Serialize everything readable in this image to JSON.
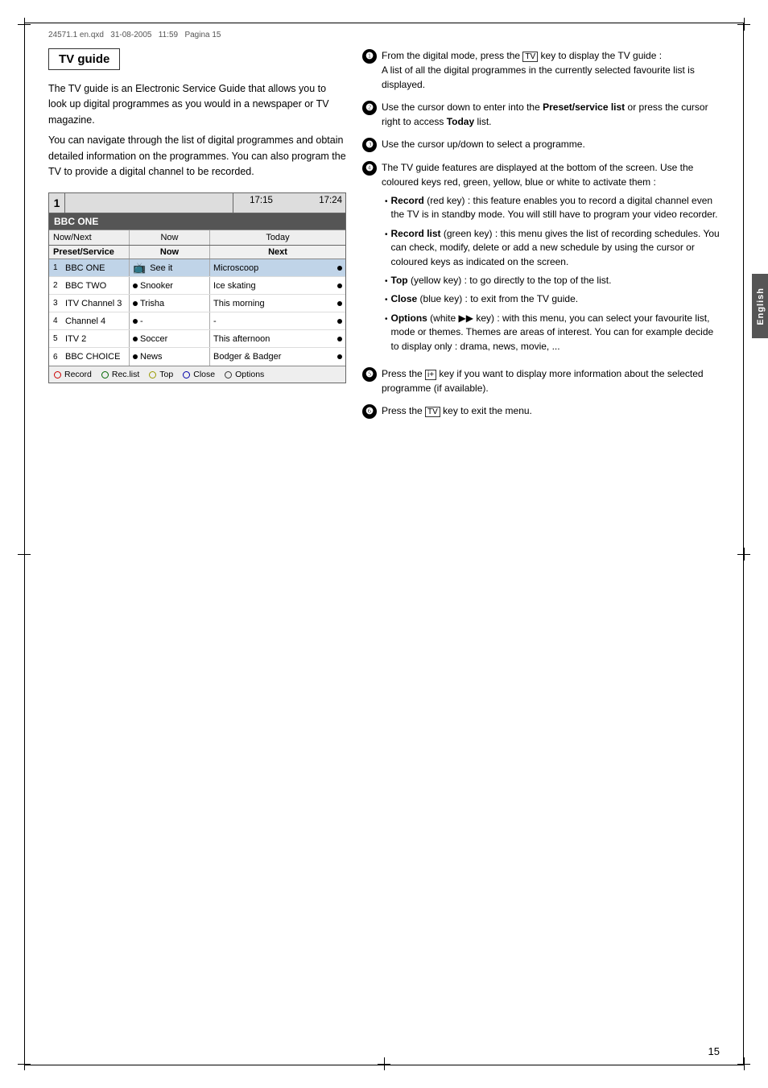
{
  "meta": {
    "doc_id": "24571.1 en.qxd",
    "date": "31-08-2005",
    "time": "11:59",
    "page_label": "Pagina 15"
  },
  "section": {
    "title": "TV guide"
  },
  "intro": {
    "paragraph1": "The TV guide is an Electronic Service Guide that allows you to look up digital programmes as you would in a newspaper or TV magazine.",
    "paragraph2": "You can navigate through the list of digital programmes and obtain detailed information on the programmes. You can also program the TV to provide a digital channel to be recorded."
  },
  "tv_guide_table": {
    "header": {
      "channel_num": "1",
      "time1": "17:15",
      "time2": "17:24"
    },
    "channel_name": "BBC ONE",
    "sub_headers": {
      "preset": "Now/Next",
      "now": "Now",
      "today": "Today"
    },
    "col_headers": {
      "preset_service": "Preset/Service",
      "now": "Now",
      "next": "Next"
    },
    "rows": [
      {
        "num": "1",
        "name": "BBC ONE",
        "now_icon": "tv",
        "now": "See it",
        "next": "Microscoop",
        "next_bullet": true,
        "highlighted": true
      },
      {
        "num": "2",
        "name": "BBC TWO",
        "now_bullet": true,
        "now": "Snooker",
        "next": "Ice skating",
        "next_bullet": true
      },
      {
        "num": "3",
        "name": "ITV Channel 3",
        "now_bullet": true,
        "now": "Trisha",
        "next": "This morning",
        "next_bullet": true
      },
      {
        "num": "4",
        "name": "Channel 4",
        "now_bullet": true,
        "now": "-",
        "next": "-",
        "next_bullet": true
      },
      {
        "num": "5",
        "name": "ITV 2",
        "now_bullet": true,
        "now": "Soccer",
        "next": "This afternoon",
        "next_bullet": true
      },
      {
        "num": "6",
        "name": "BBC CHOICE",
        "now_bullet": true,
        "now": "News",
        "next": "Bodger & Badger",
        "next_bullet": true
      }
    ],
    "bottom_buttons": [
      {
        "label": "Record",
        "color": "red"
      },
      {
        "label": "Rec.list",
        "color": "green"
      },
      {
        "label": "Top",
        "color": "yellow"
      },
      {
        "label": "Close",
        "color": "blue"
      },
      {
        "label": "Options",
        "color": "white"
      }
    ]
  },
  "instructions": {
    "steps": [
      {
        "num": "1",
        "text": "From the digital mode, press the",
        "icon": "TV-GUIDE-key",
        "text2": "key to display the TV guide :",
        "sub": "A list of all the digital programmes in the currently selected favourite list is displayed."
      },
      {
        "num": "2",
        "text": "Use the cursor down to enter into the",
        "bold": "Preset/service list",
        "text2": "or press the cursor right to access",
        "bold2": "Today",
        "text3": "list."
      },
      {
        "num": "3",
        "text": "Use the cursor up/down to select a programme."
      },
      {
        "num": "4",
        "text": "The TV guide features are displayed at the bottom of the screen. Use the coloured keys red, green, yellow, blue or white to activate them :"
      },
      {
        "num": "5",
        "text": "Press the",
        "icon": "info-key",
        "text2": "key if you want to display more information about the selected programme (if available)."
      },
      {
        "num": "6",
        "text": "Press the",
        "icon": "menu-key",
        "text2": "key to exit the menu."
      }
    ],
    "bullets": [
      {
        "label": "Record",
        "label_suffix": " (red key) : this feature enables you to record a digital channel even the TV is in standby mode. You will still have to program your video recorder."
      },
      {
        "label": "Record list",
        "label_suffix": " (green key) : this menu gives the list of recording schedules. You can check, modify, delete or add a new schedule by using the cursor or coloured keys as indicated on the screen."
      },
      {
        "label": "Top",
        "label_suffix": " (yellow key) : to go directly to the top of the list."
      },
      {
        "label": "Close",
        "label_suffix": " (blue key) : to exit from the TV guide."
      },
      {
        "label": "Options",
        "label_suffix": " (white ▶▶ key) : with this menu, you can select your favourite list, mode or themes. Themes are areas of interest. You can for example decide to display only : drama, news, movie, ..."
      }
    ]
  },
  "page_number": "15",
  "english_label": "English"
}
